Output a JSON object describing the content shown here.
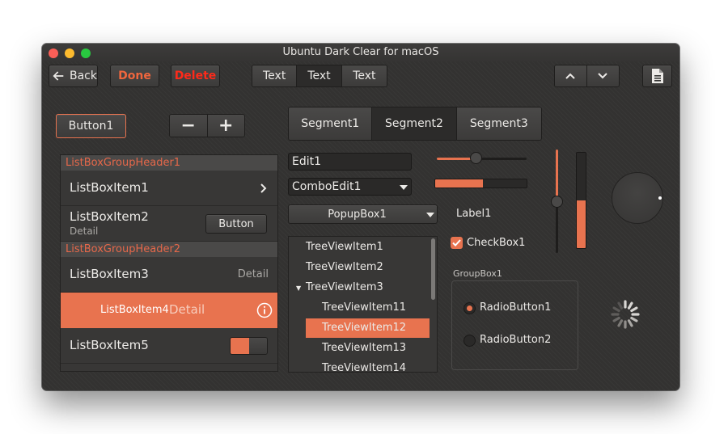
{
  "window": {
    "title": "Ubuntu Dark Clear for macOS"
  },
  "toolbar": {
    "back_label": "Back",
    "done_label": "Done",
    "delete_label": "Delete",
    "text_tabs": [
      "Text",
      "Text",
      "Text"
    ]
  },
  "controls": {
    "button1_label": "Button1",
    "minus_symbol": "−",
    "plus_symbol": "+",
    "segments": [
      "Segment1",
      "Segment2",
      "Segment3"
    ],
    "edit1_value": "Edit1",
    "combo_value": "ComboEdit1",
    "popup_value": "PopupBox1",
    "label1": "Label1",
    "checkbox_label": "CheckBox1",
    "checkbox_checked": true,
    "groupbox_title": "GroupBox1",
    "radio1_label": "RadioButton1",
    "radio2_label": "RadioButton2",
    "slider_value_pct": 43,
    "progress_value_pct": 52,
    "vslider_value_pct": 50,
    "vprogress_value_pct": 50
  },
  "listbox": {
    "header1": "ListBoxGroupHeader1",
    "header2": "ListBoxGroupHeader2",
    "item1": "ListBoxItem1",
    "item2": "ListBoxItem2",
    "item2_detail": "Detail",
    "item2_button": "Button",
    "item3": "ListBoxItem3",
    "item3_detail": "Detail",
    "item4": "ListBoxItem4",
    "item4_detail": "Detail",
    "item5": "ListBoxItem5"
  },
  "tree": {
    "items": [
      "TreeViewItem1",
      "TreeViewItem2",
      "TreeViewItem3",
      "TreeViewItem11",
      "TreeViewItem12",
      "TreeViewItem13",
      "TreeViewItem14"
    ]
  },
  "colors": {
    "accent": "#e8734f",
    "danger": "#ff2a1a",
    "done": "#f0663d"
  }
}
